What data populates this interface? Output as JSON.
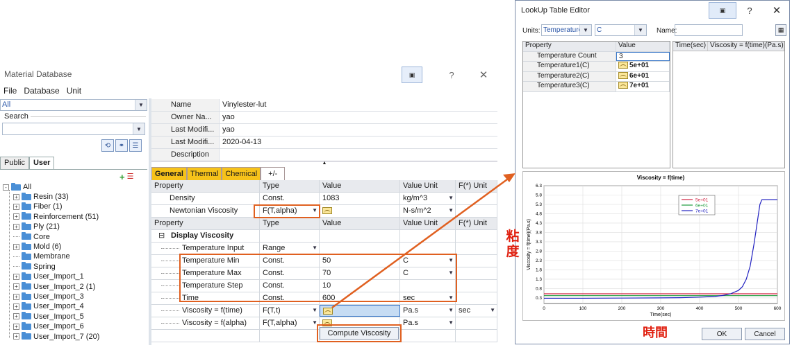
{
  "material_db": {
    "title": "Material Database",
    "menu": [
      "File",
      "Database",
      "Unit"
    ],
    "filter_value": "All",
    "search_label": "Search",
    "search_value": "",
    "tabs": [
      "Public",
      "User"
    ],
    "tree": {
      "root": "All",
      "items": [
        {
          "label": "Resin (33)",
          "expand": "+"
        },
        {
          "label": "Fiber (1)",
          "expand": "+"
        },
        {
          "label": "Reinforcement (51)",
          "expand": "+"
        },
        {
          "label": "Ply (21)",
          "expand": "+"
        },
        {
          "label": "Core",
          "expand": ""
        },
        {
          "label": "Mold (6)",
          "expand": "+"
        },
        {
          "label": "Membrane",
          "expand": ""
        },
        {
          "label": "Spring",
          "expand": ""
        },
        {
          "label": "User_Import_1",
          "expand": "+"
        },
        {
          "label": "User_Import_2 (1)",
          "expand": "+"
        },
        {
          "label": "User_Import_3",
          "expand": "+"
        },
        {
          "label": "User_Import_4",
          "expand": "+"
        },
        {
          "label": "User_Import_5",
          "expand": "+"
        },
        {
          "label": "User_Import_6",
          "expand": "+"
        },
        {
          "label": "User_Import_7 (20)",
          "expand": "+"
        }
      ]
    },
    "info": [
      {
        "key": "Name",
        "value": "Vinylester-lut"
      },
      {
        "key": "Owner Na...",
        "value": "yao"
      },
      {
        "key": "Last Modifi...",
        "value": "yao"
      },
      {
        "key": "Last Modifi...",
        "value": "2020-04-13"
      },
      {
        "key": "Description",
        "value": ""
      }
    ],
    "prop_tabs": [
      "General",
      "Thermal",
      "Chemical",
      "+/-"
    ],
    "header1": [
      "Property",
      "Type",
      "Value",
      "Value Unit",
      "F(*) Unit"
    ],
    "rows1": [
      {
        "property": "Density",
        "type": "Const.",
        "value": "1083",
        "unit": "kg/m^3"
      },
      {
        "property": "Newtonian Viscosity",
        "type": "F(T,alpha)",
        "value": "",
        "unit": "N-s/m^2"
      }
    ],
    "header2": [
      "Property",
      "Type",
      "Value",
      "Value Unit",
      "F(*) Unit"
    ],
    "section_title": "Display Viscosity",
    "section_expand": "-",
    "rows2": [
      {
        "property": "Temperature Input",
        "type": "Range",
        "value": "",
        "unit": "",
        "funit": ""
      },
      {
        "property": "Temperature Min",
        "type": "Const.",
        "value": "50",
        "unit": "C",
        "funit": ""
      },
      {
        "property": "Temperature Max",
        "type": "Const.",
        "value": "70",
        "unit": "C",
        "funit": ""
      },
      {
        "property": "Temperature Step",
        "type": "Const.",
        "value": "10",
        "unit": "",
        "funit": ""
      },
      {
        "property": "Time",
        "type": "Const.",
        "value": "600",
        "unit": "sec",
        "funit": ""
      },
      {
        "property": "Viscosity = f(time)",
        "type": "F(T,t)",
        "value": "",
        "unit": "Pa.s",
        "funit": "sec"
      },
      {
        "property": "Viscosity = f(alpha)",
        "type": "F(T,alpha)",
        "value": "",
        "unit": "Pa.s",
        "funit": ""
      }
    ],
    "compute_label": "Compute Viscosity"
  },
  "lut_editor": {
    "title": "LookUp Table Editor",
    "units_label": "Units:",
    "units_quantity": "Temperature",
    "units_unit": "C",
    "name_label": "Name:",
    "name_value": "",
    "table_header": [
      "Property",
      "Value"
    ],
    "rows": [
      {
        "property": "Temperature Count",
        "value": "3"
      },
      {
        "property": "Temperature1(C)",
        "value": "5e+01"
      },
      {
        "property": "Temperature2(C)",
        "value": "6e+01"
      },
      {
        "property": "Temperature3(C)",
        "value": "7e+01"
      }
    ],
    "table2_header": [
      "Time(sec)",
      "Viscosity = f(time)(Pa.s)"
    ],
    "ok_label": "OK",
    "cancel_label": "Cancel"
  },
  "annotations": {
    "viscosity_jp": "粘度",
    "time_jp": "時間",
    "accent": "#e06020"
  },
  "chart_data": {
    "type": "line",
    "title": "Viscosity = f(time)",
    "xlabel": "Time(sec)",
    "ylabel": "Viscosity = f(time)(Pa.s)",
    "xlim": [
      0,
      600
    ],
    "ylim": [
      0,
      6.3
    ],
    "xticks": [
      0,
      100,
      200,
      300,
      400,
      500,
      600
    ],
    "yticks": [
      0.3,
      0.8,
      1.3,
      1.8,
      2.3,
      2.8,
      3.3,
      3.8,
      4.3,
      4.8,
      5.3,
      5.8,
      6.3
    ],
    "grid": true,
    "legend_position": "top-right",
    "series": [
      {
        "name": "5e+01",
        "color": "#d02040",
        "x": [
          0,
          100,
          200,
          300,
          400,
          500,
          600
        ],
        "y": [
          0.52,
          0.52,
          0.52,
          0.52,
          0.52,
          0.52,
          0.52
        ]
      },
      {
        "name": "6e+01",
        "color": "#1a9a3a",
        "x": [
          0,
          100,
          200,
          300,
          400,
          500,
          600
        ],
        "y": [
          0.42,
          0.42,
          0.42,
          0.42,
          0.42,
          0.42,
          0.42
        ]
      },
      {
        "name": "7e+01",
        "color": "#2020c0",
        "x": [
          0,
          100,
          200,
          300,
          350,
          400,
          440,
          460,
          480,
          500,
          510,
          520,
          530,
          540,
          550,
          555,
          560,
          580,
          600
        ],
        "y": [
          0.28,
          0.28,
          0.29,
          0.3,
          0.31,
          0.34,
          0.38,
          0.43,
          0.52,
          0.7,
          0.9,
          1.3,
          2.0,
          3.2,
          4.6,
          5.3,
          5.55,
          5.55,
          5.55
        ]
      }
    ]
  }
}
